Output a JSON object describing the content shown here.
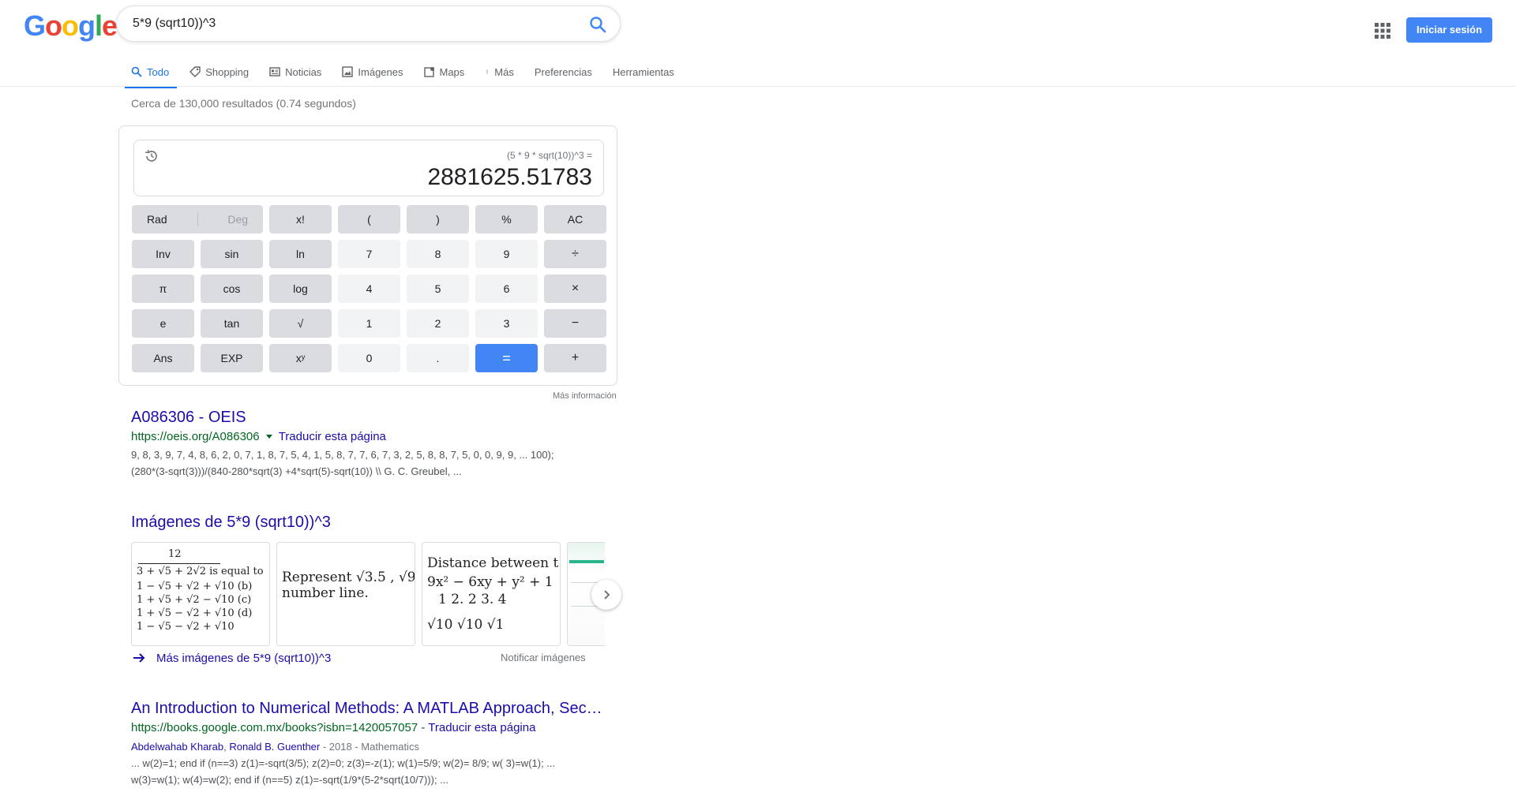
{
  "header": {
    "logo_letters": [
      {
        "char": "G",
        "color": "#4285f4"
      },
      {
        "char": "o",
        "color": "#ea4335"
      },
      {
        "char": "o",
        "color": "#fbbc05"
      },
      {
        "char": "g",
        "color": "#4285f4"
      },
      {
        "char": "l",
        "color": "#34a853"
      },
      {
        "char": "e",
        "color": "#ea4335"
      }
    ],
    "search_query": "5*9 (sqrt10))^3",
    "signin_label": "Iniciar sesión"
  },
  "tabs": [
    {
      "label": "Todo",
      "icon": "search-icon",
      "active": true
    },
    {
      "label": "Shopping",
      "icon": "tag-icon"
    },
    {
      "label": "Noticias",
      "icon": "news-icon"
    },
    {
      "label": "Imágenes",
      "icon": "image-icon"
    },
    {
      "label": "Maps",
      "icon": "map-icon"
    },
    {
      "label": "Más",
      "icon": "more-vert-icon"
    },
    {
      "label": "Preferencias"
    },
    {
      "label": "Herramientas"
    }
  ],
  "stats": "Cerca de 130,000 resultados (0.74 segundos)",
  "calculator": {
    "expression": "(5 * 9 * sqrt(10))^3 =",
    "result": "2881625.51783",
    "rad": "Rad",
    "deg": "Deg",
    "keys": [
      [
        "x!",
        "(",
        ")",
        "%",
        "AC"
      ],
      [
        "Inv",
        "sin",
        "ln",
        "7",
        "8",
        "9",
        "÷"
      ],
      [
        "π",
        "cos",
        "log",
        "4",
        "5",
        "6",
        "×"
      ],
      [
        "e",
        "tan",
        "√",
        "1",
        "2",
        "3",
        "−"
      ],
      [
        "Ans",
        "EXP",
        "xʸ",
        "0",
        ".",
        "=",
        "+"
      ]
    ],
    "more_info": "Más información"
  },
  "results": [
    {
      "title": "A086306 - OEIS",
      "url": "https://oeis.org/A086306",
      "translate": "Traducir esta página",
      "snippet_line1": "9, 8, 3, 9, 7, 4, 8, 6, 2, 0, 7, 1, 8, 7, 5, 4, 1, 5, 8, 7, 7, 6, 7, 3, 2, 5, 8, 8, 7, 5, 0, 0, 9, 9, ... 100);",
      "snippet_line2": "(280*(3-sqrt(3)))/(840-280*sqrt(3) +4*sqrt(5)-sqrt(10)) \\\\ G. C. Greubel, ..."
    },
    {
      "title": "An Introduction to Numerical Methods: A MATLAB Approach, Sec…",
      "url": "https://books.google.com.mx/books?isbn=1420057057",
      "translate": "Traducir esta página",
      "authors": "Abdelwahab Kharab",
      "authors2": "Ronald B. Guenther",
      "meta": " - 2018 - Mathematics",
      "snippet_line1": "... w(2)=1; end if (n==3) z(1)=-sqrt(3/5); z(2)=0; z(3)=-z(1); w(1)=5/9; w(2)= 8/9; w( 3)=w(1); ...",
      "snippet_line2": "w(3)=w(1); w(4)=w(2); end if (n==5) z(1)=-sqrt(1/9*(5-2*sqrt(10/7))); ..."
    }
  ],
  "images_block": {
    "title": "Imágenes de 5*9 (sqrt10))^3",
    "thumb1_lines": [
      "12",
      "3 + √5 + 2√2   is equal to",
      "1 − √5 + √2 + √10 (b)",
      "1 + √5 + √2 − √10 (c)",
      "1 + √5 − √2 + √10 (d)",
      "1 − √5 − √2 + √10"
    ],
    "thumb2_lines": [
      "Represent √3.5 , √9",
      "number line."
    ],
    "thumb3_lines": [
      "Distance  between  t",
      "9x² − 6xy + y² + 1",
      "1     2.  2     3.  4",
      "√10      √10      √1"
    ],
    "more_images": "Más imágenes de 5*9 (sqrt10))^3",
    "report": "Notificar imágenes"
  }
}
